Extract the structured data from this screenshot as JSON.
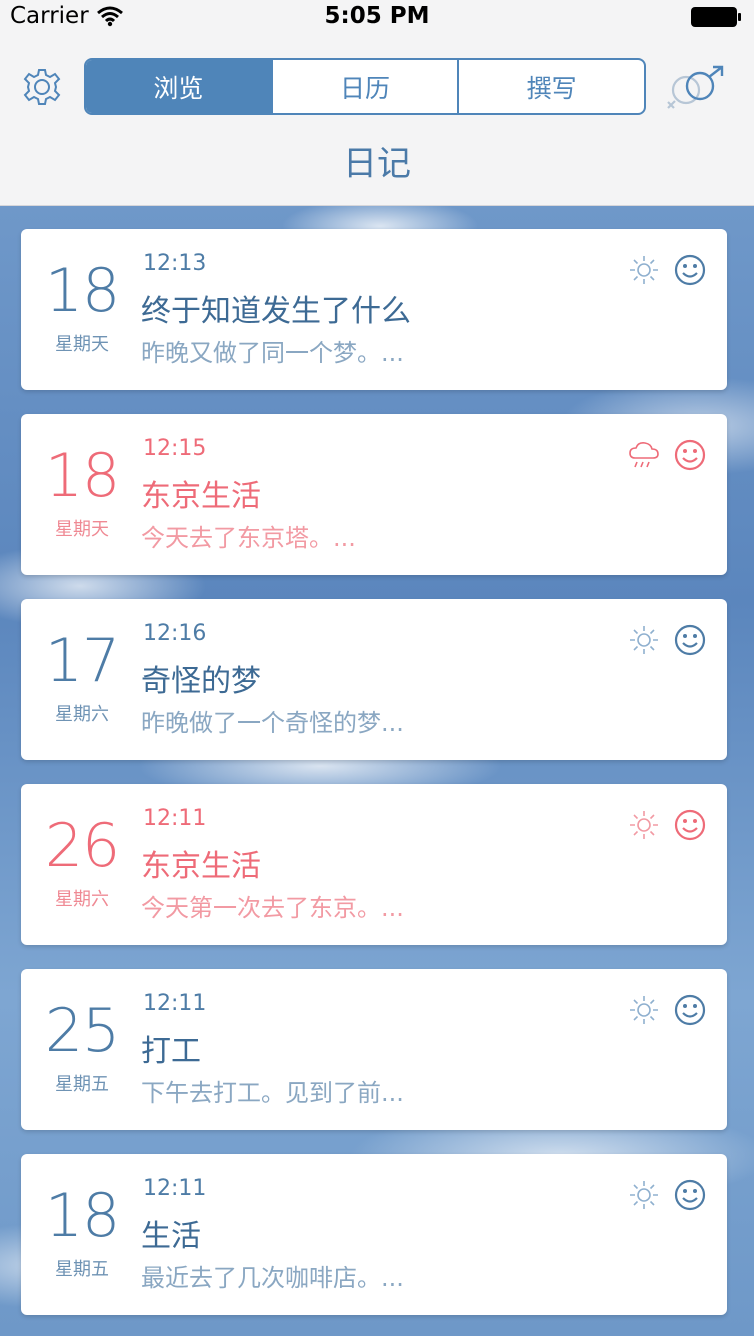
{
  "status_bar": {
    "carrier": "Carrier",
    "time": "5:05 PM"
  },
  "header": {
    "tabs": [
      {
        "label": "浏览",
        "active": true
      },
      {
        "label": "日历",
        "active": false
      },
      {
        "label": "撰写",
        "active": false
      }
    ],
    "title": "日记"
  },
  "colors": {
    "accent": "#4f85b9",
    "pink": "#ee6b78",
    "text_blue": "#4e7ca6"
  },
  "entries": [
    {
      "day": "18",
      "weekday": "星期天",
      "time": "12:13",
      "title": "终于知道发生了什么",
      "preview": "昨晚又做了同一个梦。...",
      "weather": "sun-icon",
      "mood": "smile-icon",
      "highlight": false
    },
    {
      "day": "18",
      "weekday": "星期天",
      "time": "12:15",
      "title": "东京生活",
      "preview": "今天去了东京塔。...",
      "weather": "rain-cloud-icon",
      "mood": "smile-icon",
      "highlight": true
    },
    {
      "day": "17",
      "weekday": "星期六",
      "time": "12:16",
      "title": "奇怪的梦",
      "preview": "昨晚做了一个奇怪的梦...",
      "weather": "sun-icon",
      "mood": "smile-icon",
      "highlight": false
    },
    {
      "day": "26",
      "weekday": "星期六",
      "time": "12:11",
      "title": "东京生活",
      "preview": "今天第一次去了东京。...",
      "weather": "sun-icon",
      "mood": "smile-icon",
      "highlight": true
    },
    {
      "day": "25",
      "weekday": "星期五",
      "time": "12:11",
      "title": "打工",
      "preview": "下午去打工。见到了前...",
      "weather": "sun-icon",
      "mood": "smile-icon",
      "highlight": false
    },
    {
      "day": "18",
      "weekday": "星期五",
      "time": "12:11",
      "title": "生活",
      "preview": "最近去了几次咖啡店。...",
      "weather": "sun-icon",
      "mood": "smile-icon",
      "highlight": false
    }
  ]
}
